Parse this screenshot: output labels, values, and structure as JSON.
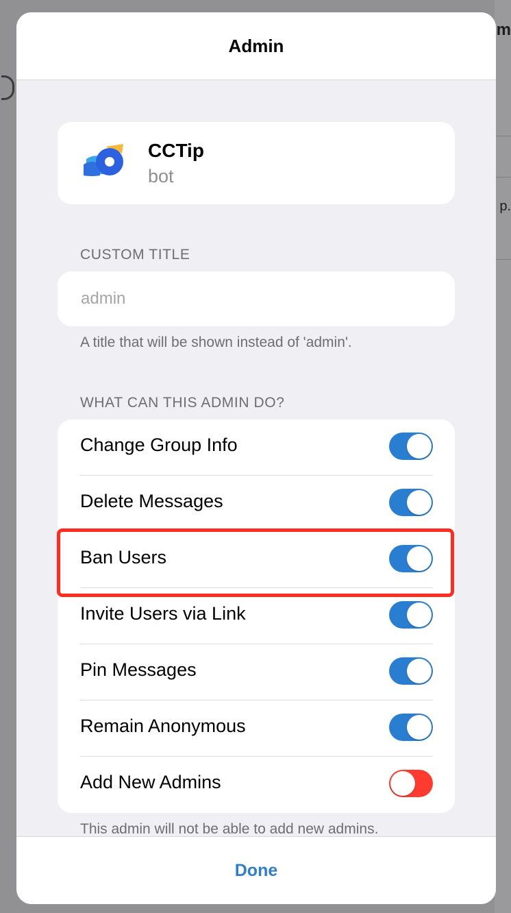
{
  "background": {
    "partial_texts": [
      "dm",
      "p."
    ]
  },
  "modal": {
    "title": "Admin",
    "bot": {
      "name": "CCTip",
      "subtitle": "bot",
      "logo_icon": "cctip-logo-icon"
    },
    "custom_title": {
      "section_label": "CUSTOM TITLE",
      "value": "",
      "placeholder": "admin",
      "hint": "A title that will be shown instead of 'admin'."
    },
    "permissions": {
      "section_label": "WHAT CAN THIS ADMIN DO?",
      "items": [
        {
          "label": "Change Group Info",
          "enabled": true
        },
        {
          "label": "Delete Messages",
          "enabled": true
        },
        {
          "label": "Ban Users",
          "enabled": true
        },
        {
          "label": "Invite Users via Link",
          "enabled": true
        },
        {
          "label": "Pin Messages",
          "enabled": true
        },
        {
          "label": "Remain Anonymous",
          "enabled": true
        },
        {
          "label": "Add New Admins",
          "enabled": false
        }
      ],
      "footer_hint": "This admin will not be able to add new admins."
    },
    "done_label": "Done",
    "colors": {
      "toggle_on": "#2a7ed1",
      "toggle_off": "#ff3b30",
      "highlight": "#ff2d20",
      "accent": "#2f7ec7"
    }
  }
}
